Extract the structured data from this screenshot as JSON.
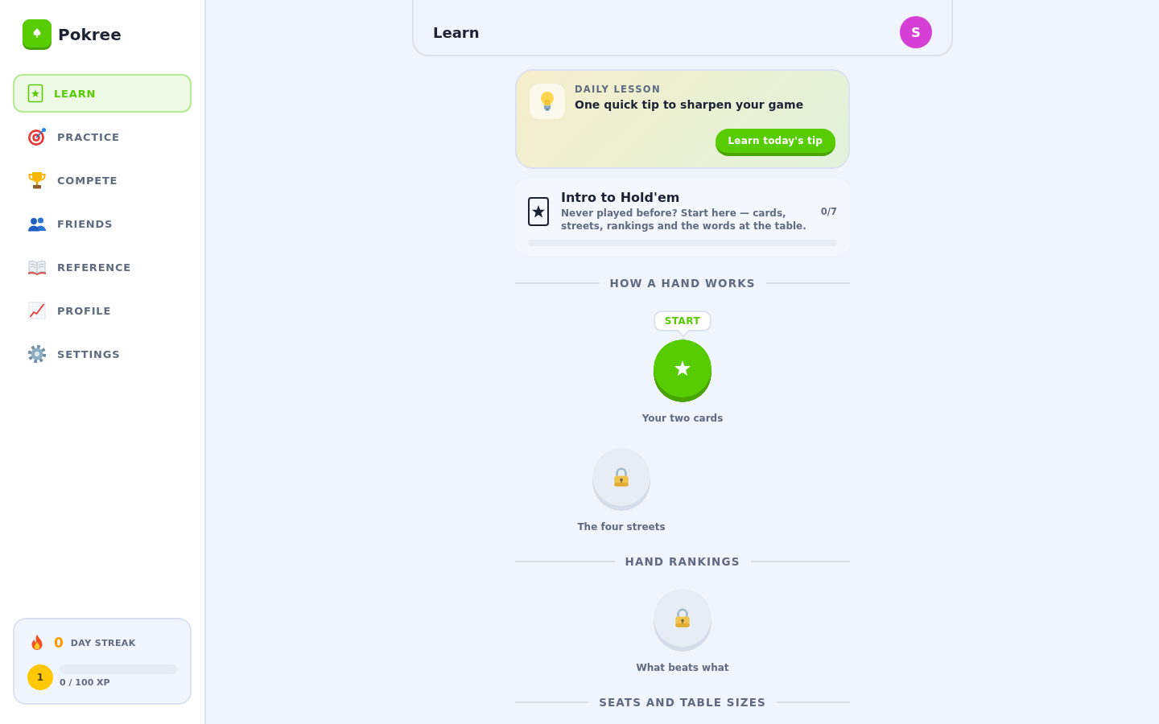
{
  "sidebar": {
    "brand": "Pokree",
    "nav": [
      {
        "label": "LEARN",
        "selected": true
      },
      {
        "label": "PRACTICE",
        "selected": false
      },
      {
        "label": "COMPETE",
        "selected": false
      },
      {
        "label": "FRIENDS",
        "selected": false
      },
      {
        "label": "REFERENCE",
        "selected": false
      },
      {
        "label": "PROFILE",
        "selected": false
      },
      {
        "label": "SETTINGS",
        "selected": false
      }
    ],
    "streak": {
      "count": "0",
      "label": "DAY STREAK",
      "user_level": "1",
      "xp": {
        "level": 0,
        "reading": "0 / 100 XP"
      }
    }
  },
  "header": {
    "title": "Learn",
    "avatar": "S"
  },
  "daily_lesson": {
    "eyebrow": "DAILY LESSON",
    "title": "One quick tip to sharpen your game",
    "button": "Learn today's tip"
  },
  "course": {
    "title": "Intro to Hold'em",
    "description": "Never played before? Start here — cards, streets, rankings and the words at the table.",
    "count": "0/7",
    "level": 0
  },
  "sections": [
    {
      "title": "HOW A HAND WORKS",
      "lessons": [
        {
          "label": "Your two cards",
          "locked": false,
          "badge": "START"
        },
        {
          "label": "The four streets",
          "locked": true
        }
      ]
    },
    {
      "title": "HAND RANKINGS",
      "lessons": [
        {
          "label": "What beats what",
          "locked": true
        }
      ]
    },
    {
      "title": "SEATS AND TABLE SIZES"
    }
  ]
}
